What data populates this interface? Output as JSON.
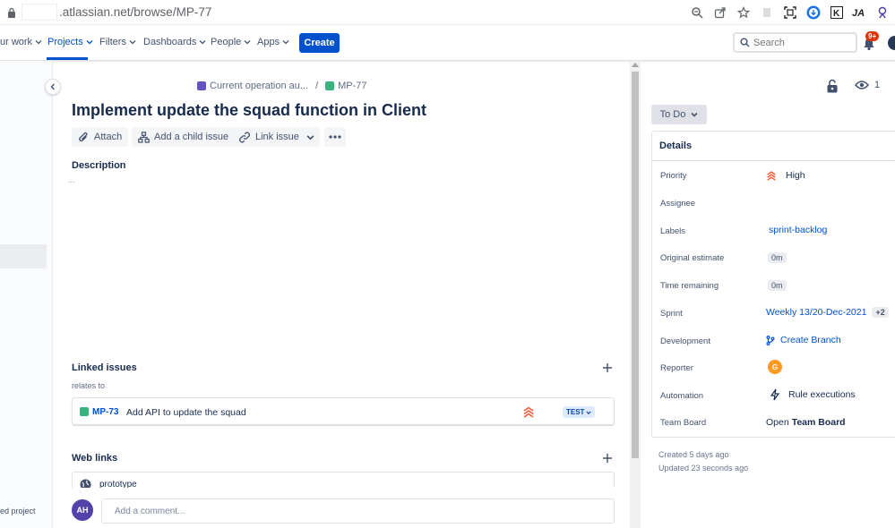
{
  "browser": {
    "url_suffix": ".atlassian.net/browse/MP-77",
    "extension_icons": [
      "zoom-icon",
      "share-icon",
      "star-icon",
      "reading-list-icon",
      "tab-capture-icon",
      "profile-sync-icon",
      "k-extension-icon",
      "ja-extension-icon",
      "gadget-extension-icon"
    ]
  },
  "nav": {
    "your_work": "ur work",
    "projects": "Projects",
    "filters": "Filters",
    "dashboards": "Dashboards",
    "people": "People",
    "apps": "Apps",
    "create": "Create",
    "search_placeholder": "Search",
    "notification_badge": "9+"
  },
  "sidebar": {
    "bottom_text": "ed project"
  },
  "issue": {
    "breadcrumb_parent": "Current operation au...",
    "breadcrumb_sep": "/",
    "key": "MP-77",
    "title": "Implement update the squad function in Client",
    "actions": {
      "attach": "Attach",
      "add_child": "Add a child issue",
      "link_issue": "Link issue"
    },
    "description_label": "Description",
    "description_dots": "...",
    "linked_issues": {
      "label": "Linked issues",
      "relation": "relates to",
      "items": [
        {
          "key": "MP-73",
          "summary": "Add API to update the squad",
          "status": "TEST"
        }
      ]
    },
    "web_links": {
      "label": "Web links",
      "items": [
        {
          "text": "prototype"
        }
      ]
    },
    "comment": {
      "avatar": "AH",
      "placeholder": "Add a comment..."
    }
  },
  "panel": {
    "watchers": "1",
    "status": "To Do",
    "details_title": "Details",
    "fields": {
      "priority_label": "Priority",
      "priority_value": "High",
      "assignee_label": "Assignee",
      "labels_label": "Labels",
      "labels_value": "sprint-backlog",
      "original_estimate_label": "Original estimate",
      "original_estimate_value": "0m",
      "time_remaining_label": "Time remaining",
      "time_remaining_value": "0m",
      "sprint_label": "Sprint",
      "sprint_value": "Weekly 13/20-Dec-2021",
      "sprint_more": "+2",
      "development_label": "Development",
      "development_value": "Create Branch",
      "reporter_label": "Reporter",
      "reporter_avatar": "G",
      "automation_label": "Automation",
      "automation_value": "Rule executions",
      "team_board_label": "Team Board",
      "team_board_prefix": "Open",
      "team_board_bold": "Team Board"
    },
    "created": "Created 5 days ago",
    "updated": "Updated 23 seconds ago"
  },
  "colors": {
    "primary": "#0052cc",
    "priority_high": "#ff5630",
    "story_green": "#36b37e",
    "epic_purple": "#6554c0"
  }
}
